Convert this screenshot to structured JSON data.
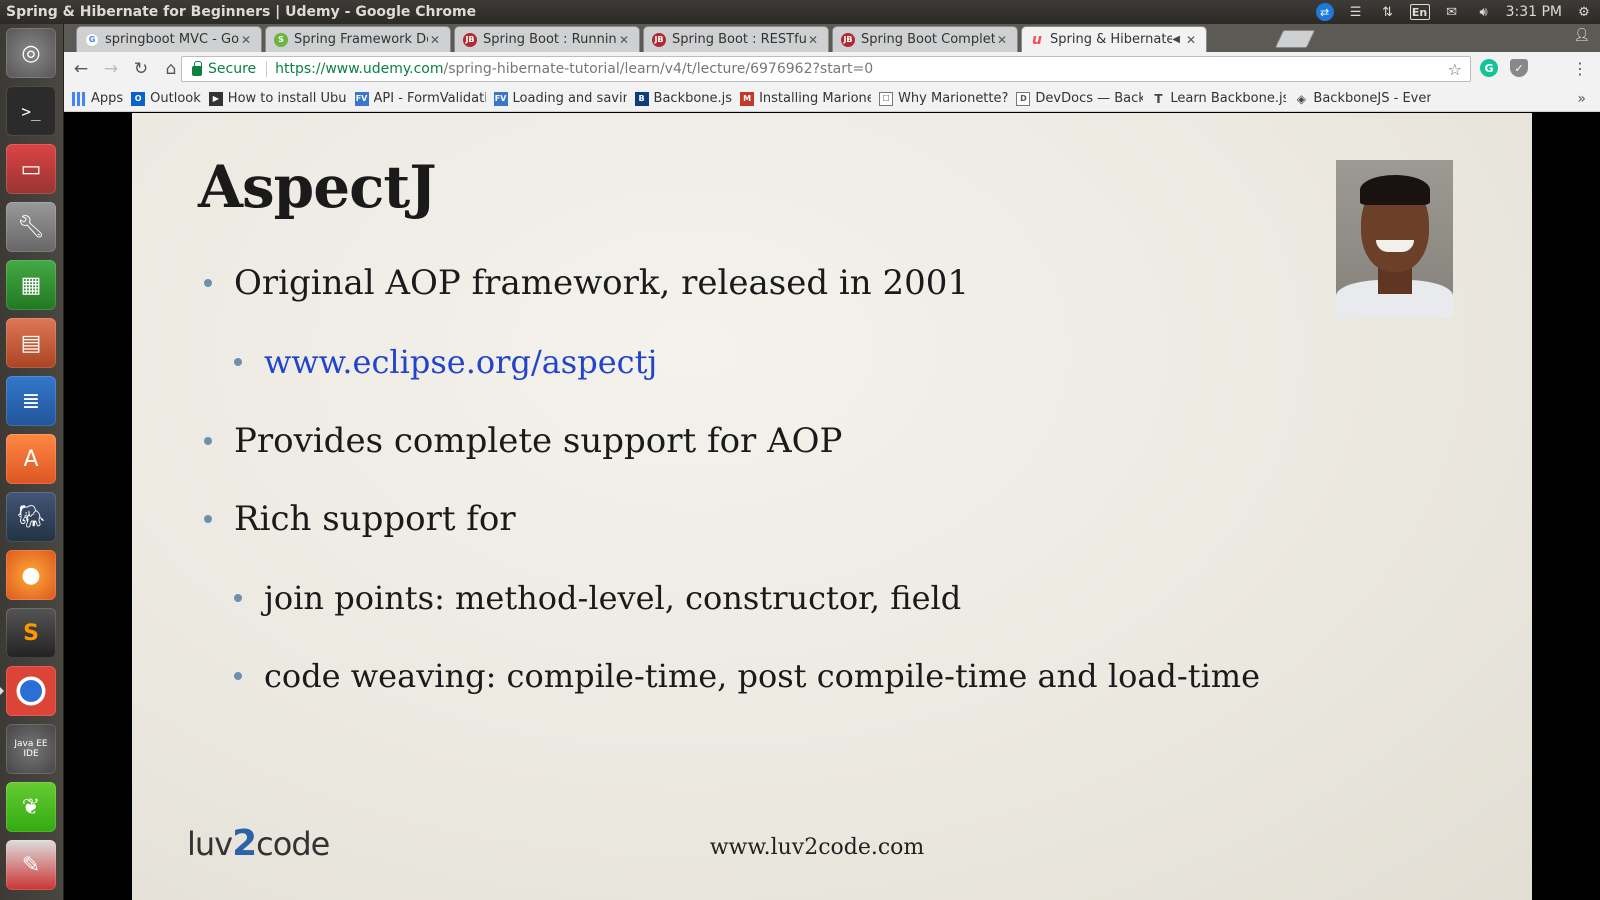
{
  "window": {
    "title": "Spring & Hibernate for Beginners | Udemy - Google Chrome"
  },
  "tray": {
    "keyboard": "En",
    "clock": "3:31 PM"
  },
  "launcher": {
    "items": [
      {
        "name": "ubuntu-dash"
      },
      {
        "name": "terminal"
      },
      {
        "name": "files"
      },
      {
        "name": "system-tools"
      },
      {
        "name": "calc"
      },
      {
        "name": "impress"
      },
      {
        "name": "writer"
      },
      {
        "name": "software-center"
      },
      {
        "name": "postgres"
      },
      {
        "name": "firefox"
      },
      {
        "name": "sublime"
      },
      {
        "name": "chrome"
      },
      {
        "name": "eclipse-javaee"
      },
      {
        "name": "spring-tool-suite"
      },
      {
        "name": "editor"
      }
    ],
    "eclipse_label": "Java EE IDE"
  },
  "tabs": [
    {
      "label": "springboot MVC - Go",
      "favicon": "G",
      "color": "#4285f4"
    },
    {
      "label": "Spring Framework Do",
      "favicon": "S",
      "color": "#6db33f"
    },
    {
      "label": "Spring Boot : Running",
      "favicon": "JB",
      "color": "#b02a30"
    },
    {
      "label": "Spring Boot : RESTful",
      "favicon": "JB",
      "color": "#b02a30"
    },
    {
      "label": "Spring Boot Complete",
      "favicon": "JB",
      "color": "#b02a30"
    },
    {
      "label": "Spring & Hibernate",
      "favicon": "u",
      "color": "#ec5252",
      "active": true
    }
  ],
  "toolbar": {
    "secure_label": "Secure",
    "url_host": "https://www.udemy.com",
    "url_path": "/spring-hibernate-tutorial/learn/v4/t/lecture/6976962?start=0"
  },
  "bookmarks": [
    {
      "label": "Apps",
      "icon": "apps-grid-icon",
      "color": "#4285f4"
    },
    {
      "label": "Outlook",
      "icon": "O",
      "color": "#0a64c8"
    },
    {
      "label": "How to install Ubu",
      "icon": "▶",
      "color": "#333"
    },
    {
      "label": "API - FormValidati",
      "icon": "FV",
      "color": "#3b77c8"
    },
    {
      "label": "Loading and saving",
      "icon": "FV",
      "color": "#3b77c8"
    },
    {
      "label": "Backbone.js",
      "icon": "B",
      "color": "#0d3e7a"
    },
    {
      "label": "Installing Marione",
      "icon": "M",
      "color": "#c0392b"
    },
    {
      "label": "Why Marionette?",
      "icon": "☐",
      "color": "#555"
    },
    {
      "label": "DevDocs — Backb",
      "icon": "D",
      "color": "#666"
    },
    {
      "label": "Learn Backbone.js",
      "icon": "T",
      "color": "#555"
    },
    {
      "label": "BackboneJS - Even",
      "icon": "◈",
      "color": "#444"
    }
  ],
  "slide": {
    "title": "AspectJ",
    "bullets": [
      {
        "text": "Original AOP framework, released in 2001",
        "level": 1
      },
      {
        "text": "www.eclipse.org/aspectj",
        "level": 2,
        "link": true
      },
      {
        "text": "Provides complete support for AOP",
        "level": 1
      },
      {
        "text": "Rich support for",
        "level": 1
      },
      {
        "text": "join points: method-level, constructor, field",
        "level": 2
      },
      {
        "text": "code weaving: compile-time, post compile-time and load-time",
        "level": 2
      }
    ],
    "logo": {
      "part1": "luv",
      "part2": "2",
      "part3": "code"
    },
    "website": "www.luv2code.com"
  }
}
